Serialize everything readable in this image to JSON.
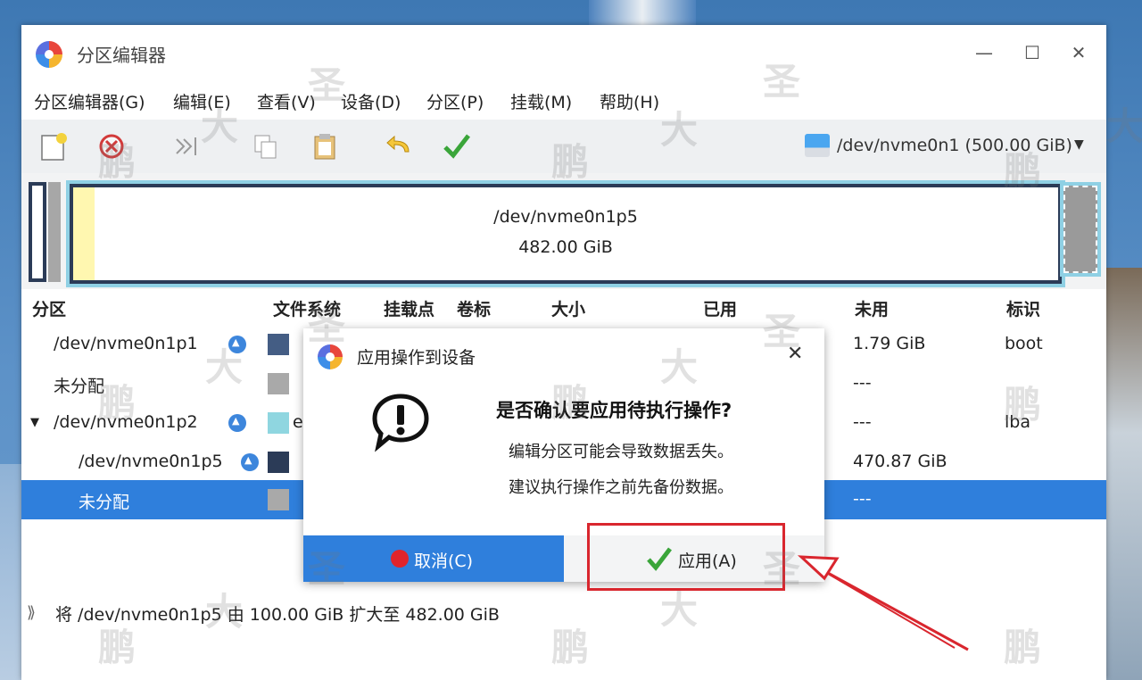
{
  "window": {
    "title": "分区编辑器"
  },
  "menu": [
    "分区编辑器(G)",
    "编辑(E)",
    "查看(V)",
    "设备(D)",
    "分区(P)",
    "挂载(M)",
    "帮助(H)"
  ],
  "toolbar": {
    "buttons": [
      "new-icon",
      "delete-icon",
      "resize-move-icon",
      "copy-icon",
      "paste-icon",
      "undo-icon",
      "apply-icon"
    ],
    "device": "/dev/nvme0n1 (500.00 GiB)"
  },
  "partition_map": {
    "name": "/dev/nvme0n1p5",
    "size": "482.00 GiB"
  },
  "columns": [
    "分区",
    "文件系统",
    "挂载点",
    "卷标",
    "大小",
    "已用",
    "未用",
    "标识"
  ],
  "rows": [
    {
      "partition": "/dev/nvme0n1p1",
      "fs_partial": "",
      "unused": "1.79 GiB",
      "flags": "boot"
    },
    {
      "partition": "未分配",
      "fs_partial": "",
      "unused": "---",
      "flags": ""
    },
    {
      "partition": "/dev/nvme0n1p2",
      "fs_partial": "e",
      "unused": "---",
      "flags": "lba"
    },
    {
      "partition": "/dev/nvme0n1p5",
      "fs_partial": "",
      "unused": "470.87 GiB",
      "flags": ""
    },
    {
      "partition": "未分配",
      "fs_partial": "",
      "unused": "---",
      "flags": ""
    }
  ],
  "status": {
    "text": "将 /dev/nvme0n1p5 由 100.00 GiB 扩大至 482.00 GiB"
  },
  "dialog": {
    "title": "应用操作到设备",
    "heading": "是否确认要应用待执行操作?",
    "message1": "编辑分区可能会导致数据丢失。",
    "message2": "建议执行操作之前先备份数据。",
    "cancel_label": "取消(C)",
    "apply_label": "应用(A)"
  },
  "watermark": "大鹏圣"
}
